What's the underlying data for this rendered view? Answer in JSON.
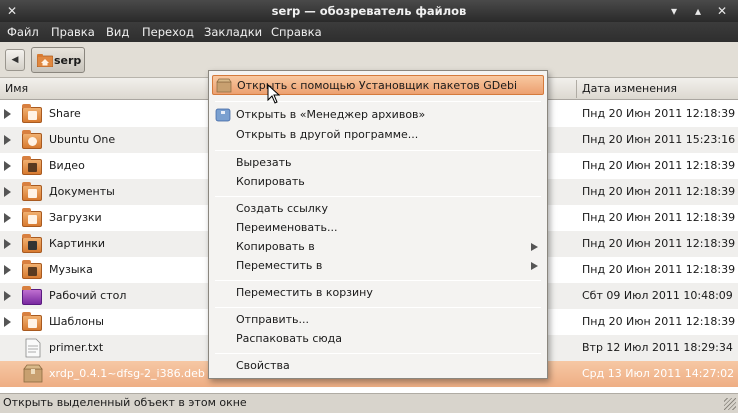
{
  "window": {
    "title": "serp — обозреватель файлов"
  },
  "menubar": [
    "Файл",
    "Правка",
    "Вид",
    "Переход",
    "Закладки",
    "Справка"
  ],
  "toolbar": {
    "back_icon": "◀",
    "path_label": "serp"
  },
  "columns": {
    "name": "Имя",
    "date": "Дата изменения"
  },
  "files": [
    {
      "name": "Share",
      "date": "Пнд 20 Июн 2011 12:18:39",
      "icon": "folder-share-icon"
    },
    {
      "name": "Ubuntu One",
      "date": "Пнд 20 Июн 2011 15:23:16",
      "icon": "folder-ubuntu-one-icon"
    },
    {
      "name": "Видео",
      "date": "Пнд 20 Июн 2011 12:18:39",
      "icon": "folder-video-icon"
    },
    {
      "name": "Документы",
      "date": "Пнд 20 Июн 2011 12:18:39",
      "icon": "folder-documents-icon"
    },
    {
      "name": "Загрузки",
      "date": "Пнд 20 Июн 2011 12:18:39",
      "icon": "folder-downloads-icon"
    },
    {
      "name": "Картинки",
      "date": "Пнд 20 Июн 2011 12:18:39",
      "icon": "folder-pictures-icon"
    },
    {
      "name": "Музыка",
      "date": "Пнд 20 Июн 2011 12:18:39",
      "icon": "folder-music-icon"
    },
    {
      "name": "Рабочий стол",
      "date": "Сбт 09 Июл 2011 10:48:09",
      "icon": "folder-desktop-icon"
    },
    {
      "name": "Шаблоны",
      "date": "Пнд 20 Июн 2011 12:18:39",
      "icon": "folder-templates-icon"
    },
    {
      "name": "primer.txt",
      "date": "Втр 12 Июл 2011 18:29:34",
      "icon": "text-file-icon"
    },
    {
      "name": "xrdp_0.4.1~dfsg-2_i386.deb",
      "date": "Срд 13 Июл 2011 14:27:02",
      "icon": "package-icon"
    }
  ],
  "context_menu": {
    "open_gdebi": "Открыть с помощью Установщик пакетов GDebi",
    "open_archive": "Открыть в «Менеджер архивов»",
    "open_other": "Открыть в другой программе...",
    "cut": "Вырезать",
    "copy": "Копировать",
    "make_link": "Создать ссылку",
    "rename": "Переименовать...",
    "copy_to": "Копировать в",
    "move_to": "Переместить в",
    "trash": "Переместить в корзину",
    "send": "Отправить...",
    "extract": "Распаковать сюда",
    "properties": "Свойства"
  },
  "status": {
    "text": "Открыть выделенный объект в этом окне"
  },
  "colors": {
    "selection": "#eeae84",
    "menu_highlight": "#eca070",
    "folder": "#d87a30"
  }
}
